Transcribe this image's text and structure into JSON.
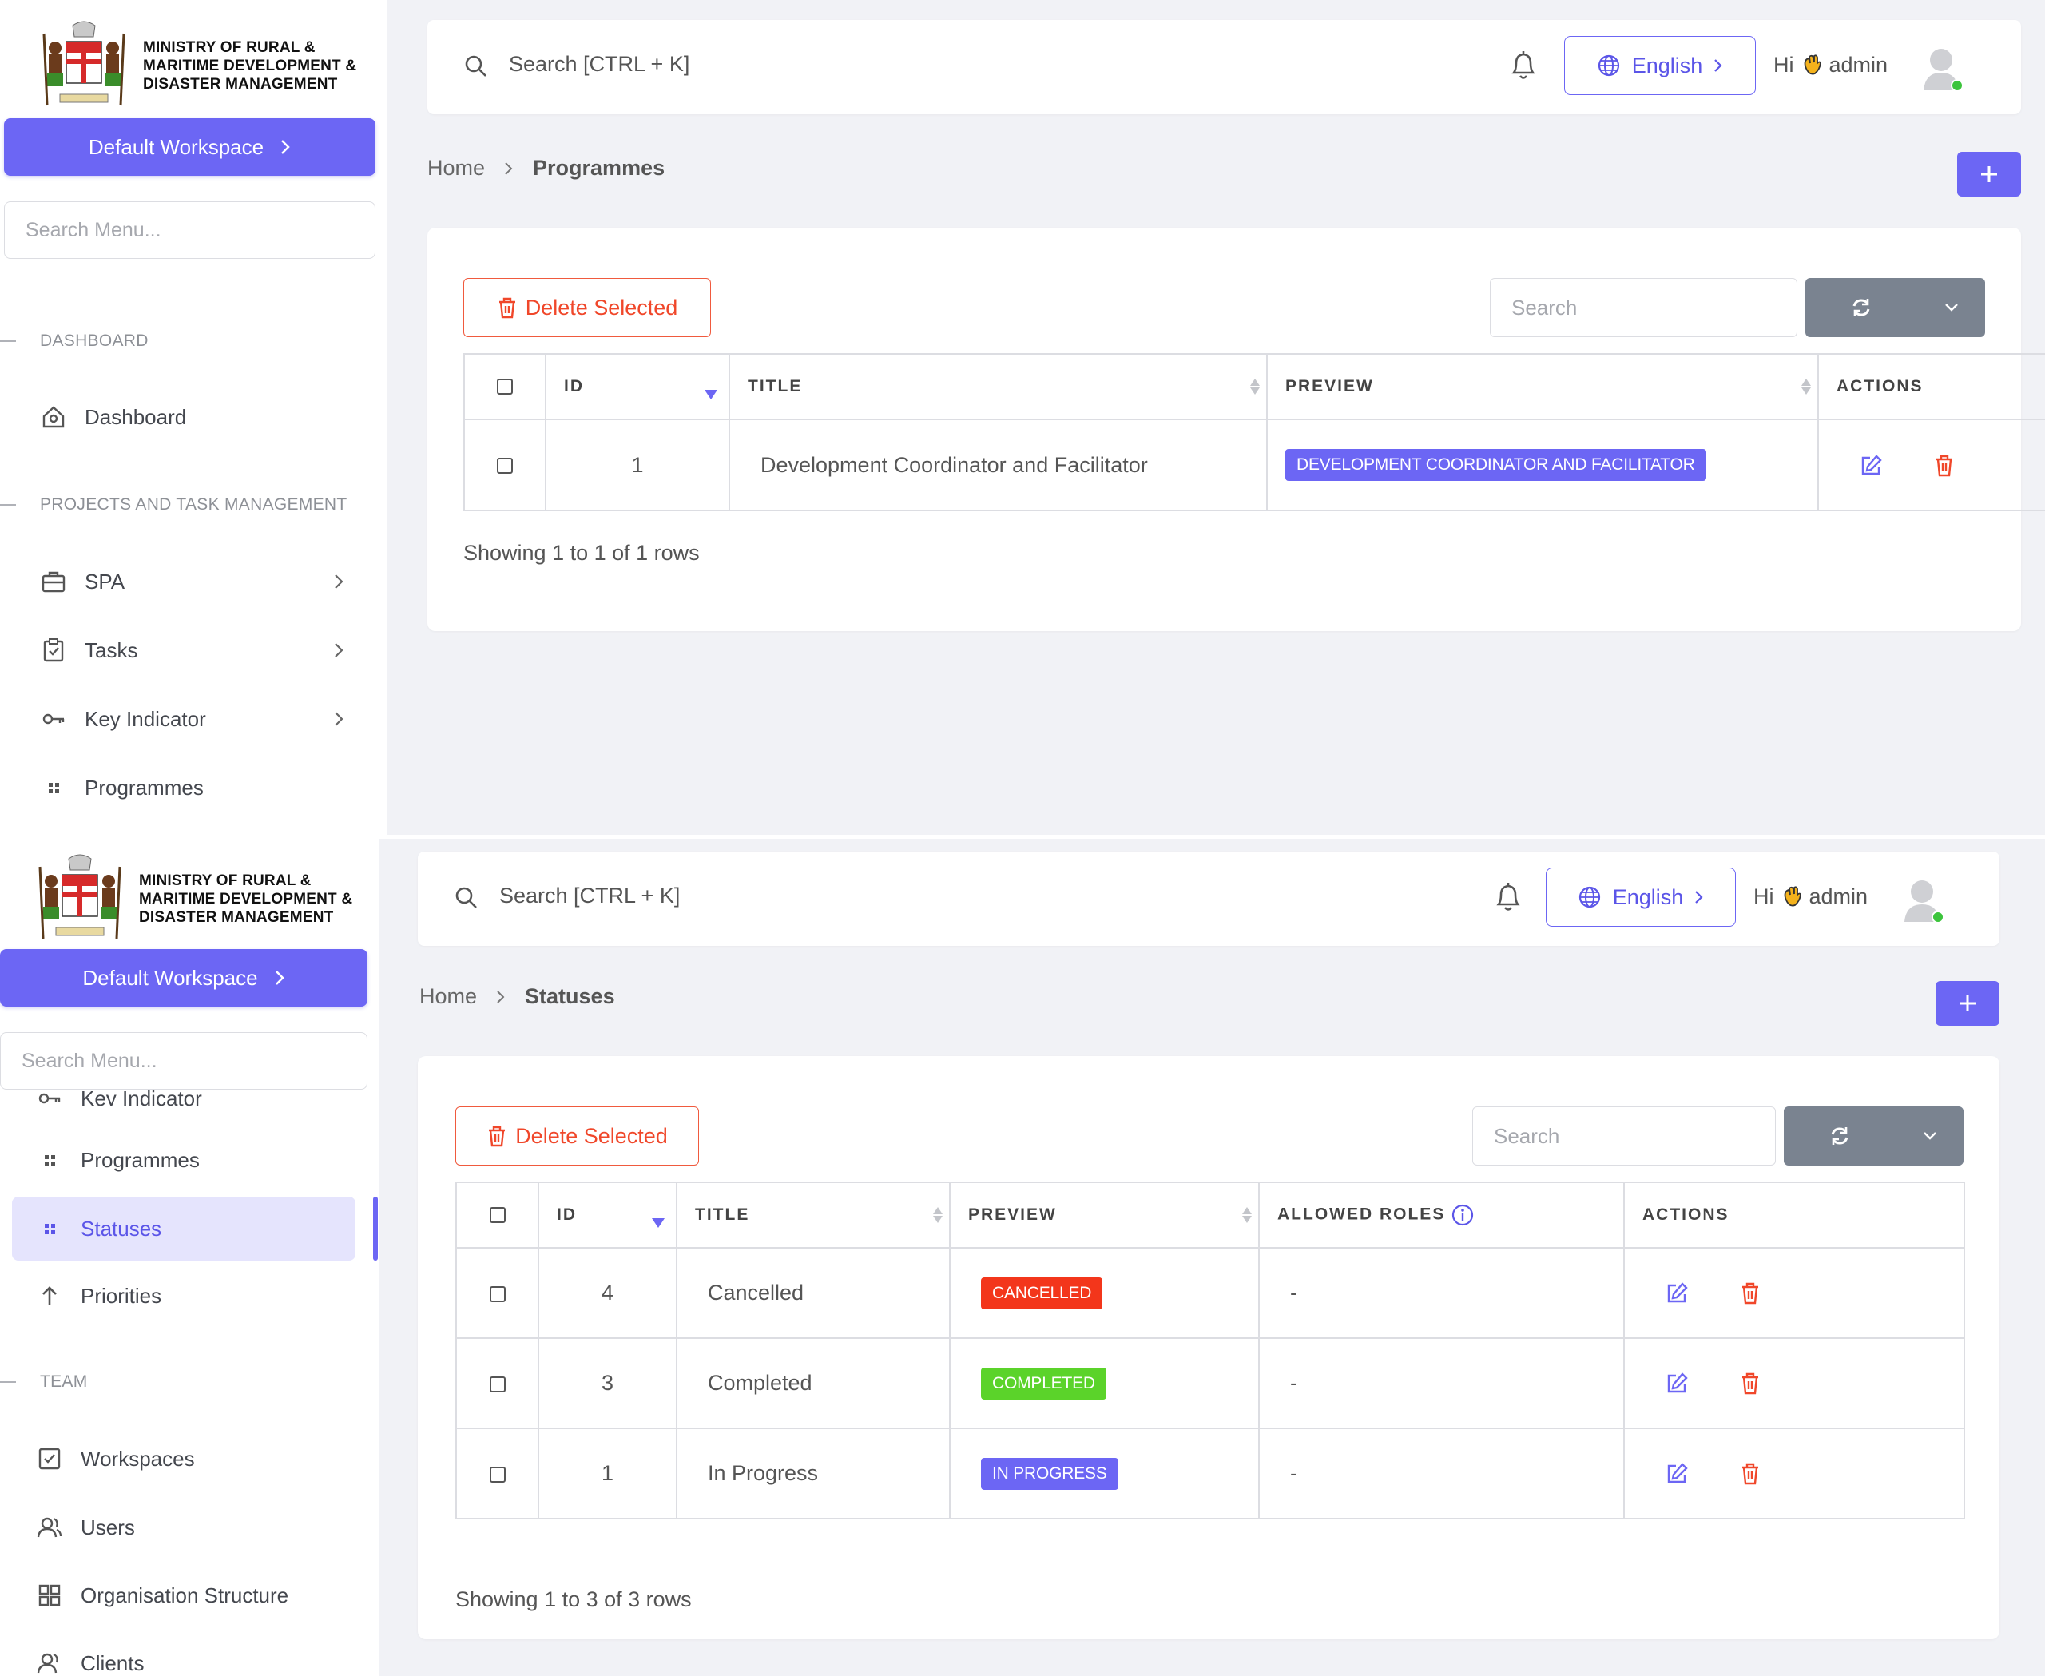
{
  "org": {
    "line1": "MINISTRY OF RURAL &",
    "line2": "MARITIME DEVELOPMENT &",
    "line3": "DISASTER MANAGEMENT"
  },
  "colors": {
    "accent": "#6c66f4",
    "danger": "#f0472a",
    "cancelled": "#f3361b",
    "completed": "#5bd32a",
    "in_progress": "#6c66f4",
    "refresh_btn": "#7a8390"
  },
  "sidebar": {
    "workspace_label": "Default Workspace",
    "search_placeholder": "Search Menu...",
    "sections": {
      "dashboard": "DASHBOARD",
      "projects": "PROJECTS AND TASK MANAGEMENT",
      "team": "TEAM"
    },
    "items": {
      "dashboard": "Dashboard",
      "spa": "SPA",
      "tasks": "Tasks",
      "key_indicator": "Key Indicator",
      "programmes": "Programmes",
      "statuses": "Statuses",
      "priorities": "Priorities",
      "workspaces": "Workspaces",
      "users": "Users",
      "org_structure": "Organisation Structure",
      "clients": "Clients"
    }
  },
  "header": {
    "search_text": "Search [CTRL + K]",
    "language": "English",
    "greeting_prefix": "Hi",
    "username": "admin"
  },
  "breadcrumb": {
    "home": "Home",
    "programmes": "Programmes",
    "statuses": "Statuses"
  },
  "toolbar": {
    "delete_selected": "Delete Selected",
    "search_placeholder": "Search"
  },
  "programmes_table": {
    "headers": {
      "id": "ID",
      "title": "TITLE",
      "preview": "PREVIEW",
      "actions": "ACTIONS"
    },
    "rows": [
      {
        "id": "1",
        "title": "Development Coordinator and Facilitator",
        "preview": "DEVELOPMENT COORDINATOR AND FACILITATOR"
      }
    ],
    "footer": "Showing 1 to 1 of 1 rows"
  },
  "statuses_table": {
    "headers": {
      "id": "ID",
      "title": "TITLE",
      "preview": "PREVIEW",
      "allowed_roles": "ALLOWED ROLES",
      "actions": "ACTIONS"
    },
    "rows": [
      {
        "id": "4",
        "title": "Cancelled",
        "preview": "CANCELLED",
        "roles": "-"
      },
      {
        "id": "3",
        "title": "Completed",
        "preview": "COMPLETED",
        "roles": "-"
      },
      {
        "id": "1",
        "title": "In Progress",
        "preview": "IN PROGRESS",
        "roles": "-"
      }
    ],
    "footer": "Showing 1 to 3 of 3 rows"
  }
}
